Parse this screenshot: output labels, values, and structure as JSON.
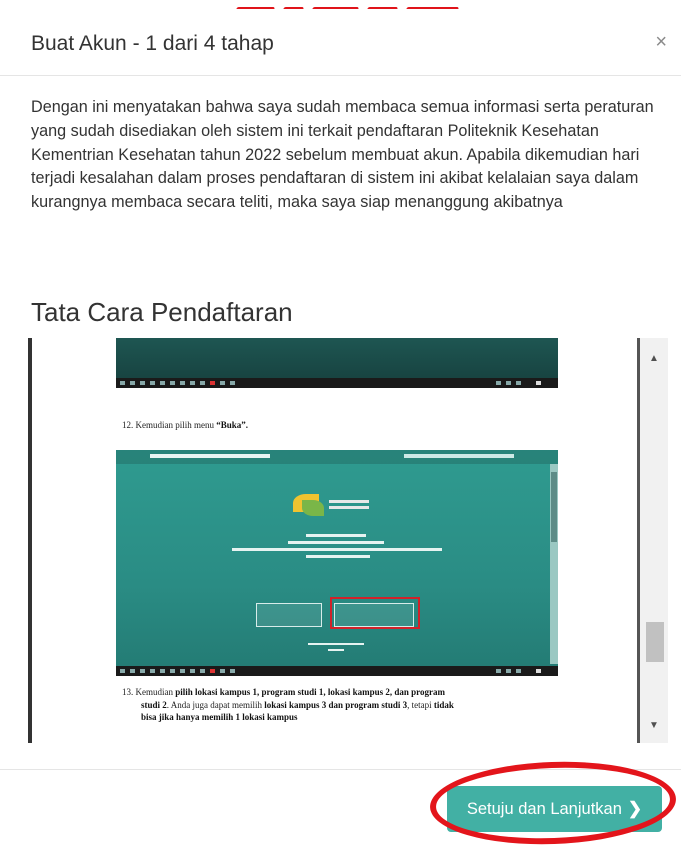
{
  "modal": {
    "title": "Buat Akun - 1 dari 4 tahap",
    "close_label": "×"
  },
  "intro_text": "Dengan ini menyatakan bahwa saya sudah membaca semua informasi serta peraturan yang sudah disediakan oleh sistem ini terkait pendaftaran Politeknik Kesehatan Kementrian Kesehatan tahun 2022 sebelum membuat akun. Apabila dikemudian hari terjadi kesalahan dalam proses pendaftaran di sistem ini akibat kelalaian saya dalam kurangnya membaca secara teliti, maka saya siap menanggung akibatnya",
  "section_title": "Tata Cara Pendaftaran",
  "document": {
    "step12_prefix": "12. Kemudian pilih menu ",
    "step12_bold": "“Buka”.",
    "step13_line1_prefix": "13. Kemudian ",
    "step13_line1_bold": "pilih lokasi kampus 1, program studi 1, lokasi kampus 2, dan program",
    "step13_line2_bold": "studi 2",
    "step13_line2_rest": ". Anda juga dapat memilih ",
    "step13_line2_bold2": "lokasi kampus 3 dan program studi 3",
    "step13_line2_rest2": ", tetapi ",
    "step13_line2_bold3": "tidak",
    "step13_line3": "bisa jika hanya memilih 1 lokasi kampus"
  },
  "scroll": {
    "up_arrow": "▲",
    "down_arrow": "▼"
  },
  "footer": {
    "next_button_label": "Setuju dan Lanjutkan",
    "next_chevron": "❯"
  },
  "colors": {
    "button_bg": "#42b0a4",
    "annotation_red": "#e3151b",
    "screenshot_teal": "#2a8c84"
  }
}
